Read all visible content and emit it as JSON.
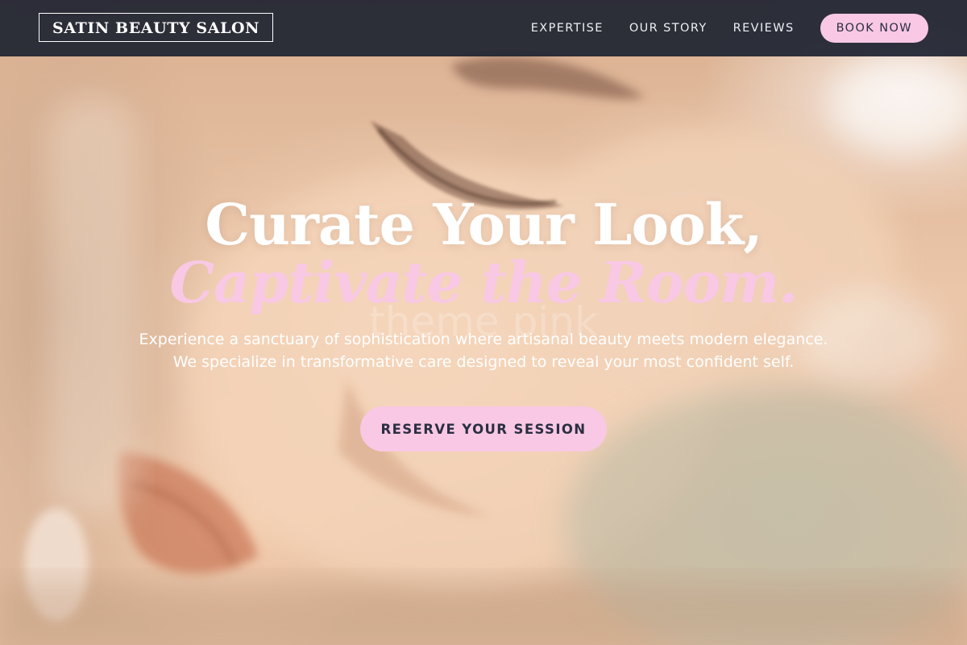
{
  "nav": {
    "brand": "SATIN BEAUTY SALON",
    "links": [
      {
        "label": "EXPERTISE"
      },
      {
        "label": "OUR STORY"
      },
      {
        "label": "REVIEWS"
      }
    ],
    "cta_label": "BOOK NOW"
  },
  "hero": {
    "headline_line1": "Curate Your Look,",
    "headline_line2": "Captivate the Room.",
    "subtext_line1": "Experience a sanctuary of sophistication where artisanal beauty meets modern elegance.",
    "subtext_line2": "We specialize in transformative care designed to reveal your most confident self.",
    "cta_label": "RESERVE YOUR SESSION",
    "watermark": "theme pink",
    "background_image": "close-up-face-with-closed-eyes"
  },
  "colors": {
    "nav_background": "#1e2432",
    "accent_pink": "#f9c8e4",
    "button_text": "#2a2f42",
    "headline_white": "#ffffff"
  }
}
